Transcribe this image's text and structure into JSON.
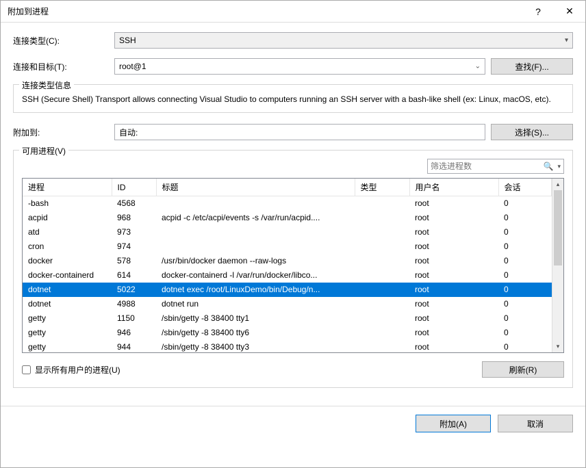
{
  "titlebar": {
    "title": "附加到进程",
    "help_symbol": "?",
    "close_symbol": "✕"
  },
  "labels": {
    "connection_type": "连接类型(C):",
    "connection_target": "连接和目标(T):",
    "attach_to": "附加到:",
    "find_btn": "查找(F)...",
    "select_btn": "选择(S)...",
    "refresh_btn": "刷新(R)",
    "attach_btn": "附加(A)",
    "cancel_btn": "取消"
  },
  "fields": {
    "connection_type_value": "SSH",
    "connection_target_value": "root@1",
    "attach_to_value": "自动:"
  },
  "info_group": {
    "title": "连接类型信息",
    "text": "SSH (Secure Shell) Transport allows connecting Visual Studio to computers running an SSH server with a bash-like shell (ex: Linux, macOS, etc)."
  },
  "processes_group": {
    "title": "可用进程(V)",
    "filter_placeholder": "筛选进程数",
    "show_all_users_label": "显示所有用户的进程(U)",
    "headers": {
      "process": "进程",
      "id": "ID",
      "title": "标题",
      "type": "类型",
      "user": "用户名",
      "session": "会话"
    },
    "rows": [
      {
        "proc": "-bash",
        "id": "4568",
        "title": "",
        "type": "",
        "user": "root",
        "session": "0",
        "selected": false
      },
      {
        "proc": "acpid",
        "id": "968",
        "title": "acpid -c /etc/acpi/events -s /var/run/acpid....",
        "type": "",
        "user": "root",
        "session": "0",
        "selected": false
      },
      {
        "proc": "atd",
        "id": "973",
        "title": "",
        "type": "",
        "user": "root",
        "session": "0",
        "selected": false
      },
      {
        "proc": "cron",
        "id": "974",
        "title": "",
        "type": "",
        "user": "root",
        "session": "0",
        "selected": false
      },
      {
        "proc": "docker",
        "id": "578",
        "title": "/usr/bin/docker daemon --raw-logs",
        "type": "",
        "user": "root",
        "session": "0",
        "selected": false
      },
      {
        "proc": "docker-containerd",
        "id": "614",
        "title": "docker-containerd -l /var/run/docker/libco...",
        "type": "",
        "user": "root",
        "session": "0",
        "selected": false
      },
      {
        "proc": "dotnet",
        "id": "5022",
        "title": "dotnet exec /root/LinuxDemo/bin/Debug/n...",
        "type": "",
        "user": "root",
        "session": "0",
        "selected": true
      },
      {
        "proc": "dotnet",
        "id": "4988",
        "title": "dotnet run",
        "type": "",
        "user": "root",
        "session": "0",
        "selected": false
      },
      {
        "proc": "getty",
        "id": "1150",
        "title": "/sbin/getty -8 38400 tty1",
        "type": "",
        "user": "root",
        "session": "0",
        "selected": false
      },
      {
        "proc": "getty",
        "id": "946",
        "title": "/sbin/getty -8 38400 tty6",
        "type": "",
        "user": "root",
        "session": "0",
        "selected": false
      },
      {
        "proc": "getty",
        "id": "944",
        "title": "/sbin/getty -8 38400 tty3",
        "type": "",
        "user": "root",
        "session": "0",
        "selected": false
      }
    ]
  }
}
